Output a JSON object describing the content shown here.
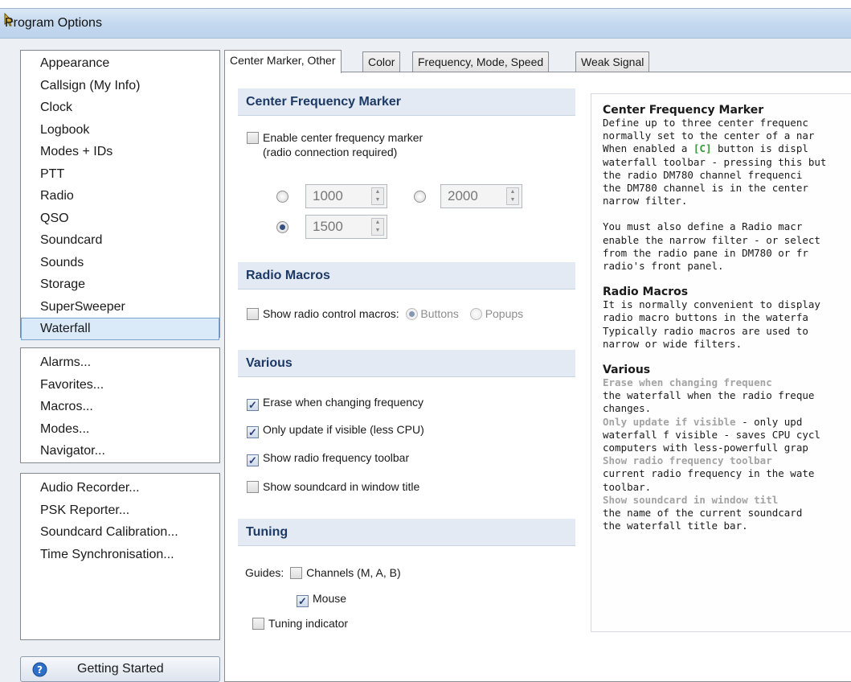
{
  "window": {
    "title": "Program Options"
  },
  "nav": {
    "group1": [
      "Appearance",
      "Callsign (My Info)",
      "Clock",
      "Logbook",
      "Modes + IDs",
      "PTT",
      "Radio",
      "QSO",
      "Soundcard",
      "Sounds",
      "Storage",
      "SuperSweeper",
      "Waterfall"
    ],
    "group2": [
      "Alarms...",
      "Favorites...",
      "Macros...",
      "Modes...",
      "Navigator..."
    ],
    "group3": [
      "Audio Recorder...",
      "PSK Reporter...",
      "Soundcard Calibration...",
      "Time Synchronisation..."
    ],
    "selected": "Waterfall",
    "getting_started": "Getting Started"
  },
  "tabs": [
    "Center Marker, Other",
    "Color",
    "Frequency, Mode, Speed",
    "Weak Signal"
  ],
  "active_tab": "Center Marker, Other",
  "center_marker": {
    "header": "Center Frequency Marker",
    "enable_label_1": "Enable center frequency marker",
    "enable_label_2": "(radio connection required)",
    "enabled": false,
    "freq_a": "1000",
    "freq_b": "2000",
    "freq_c": "1500",
    "selected_freq": "1500"
  },
  "radio_macros": {
    "header": "Radio Macros",
    "show_label": "Show radio control macros:",
    "opt_buttons": "Buttons",
    "opt_popups": "Popups",
    "show_checked": false
  },
  "various": {
    "header": "Various",
    "erase": "Erase when changing frequency",
    "only_update": "Only update if visible (less CPU)",
    "show_toolbar": "Show radio frequency toolbar",
    "show_soundcard": "Show soundcard in window title",
    "erase_checked": true,
    "only_update_checked": true,
    "show_toolbar_checked": true,
    "show_soundcard_checked": false
  },
  "tuning": {
    "header": "Tuning",
    "guides_label": "Guides:",
    "channels": "Channels (M, A, B)",
    "mouse": "Mouse",
    "tuning_indicator": "Tuning indicator",
    "channels_checked": false,
    "mouse_checked": true,
    "tuning_indicator_checked": false
  },
  "help": {
    "h1": "Center Frequency Marker",
    "p1": [
      "Define up to three center frequenc",
      "normally set to the center of a nar"
    ],
    "p1b_pre": "When enabled a ",
    "p1b_code": "[C]",
    "p1b_post": " button is displ",
    "p1c": [
      "waterfall toolbar - pressing this but",
      "the radio DM780 channel frequenci",
      "the DM780 channel is in the center",
      "narrow filter."
    ],
    "p2": [
      "You must also define a Radio macr",
      "enable the narrow filter - or select",
      "from the radio pane in DM780 or fr",
      "radio's front panel."
    ],
    "h2": "Radio Macros",
    "p3": [
      "It is normally convenient to display",
      "radio macro buttons in the waterfa",
      "Typically radio macros are used to",
      "narrow or wide filters."
    ],
    "h3": "Various",
    "v1_title": "Erase when changing frequenc",
    "v1": [
      "the waterfall when the radio freque",
      "changes."
    ],
    "v2_title": "Only update if visible",
    "v2_rest": " - only upd",
    "v2": [
      "waterfall f visible - saves CPU cycl",
      "computers with less-powerfull grap"
    ],
    "v3_title": "Show radio frequency toolbar",
    "v3": [
      "current radio frequency in the wate",
      "toolbar."
    ],
    "v4_title": "Show soundcard in window titl",
    "v4": [
      "the name of the current soundcard",
      "the waterfall title bar."
    ]
  }
}
